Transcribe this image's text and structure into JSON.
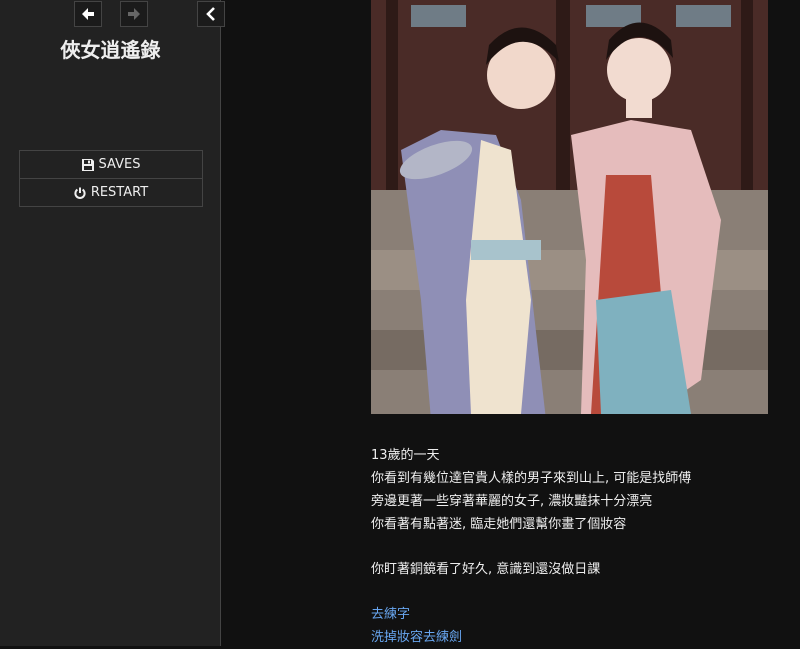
{
  "sidebar": {
    "title": "俠女逍遙錄",
    "nav": {
      "back_icon": "arrow-left-icon",
      "forward_icon": "arrow-right-icon",
      "toggle_icon": "chevron-left-icon"
    },
    "menu": [
      {
        "label": "SAVES",
        "icon": "floppy-disk-icon"
      },
      {
        "label": "RESTART",
        "icon": "power-icon"
      }
    ]
  },
  "passage": {
    "lines": [
      "13歲的一天",
      "你看到有幾位達官貴人樣的男子來到山上, 可能是找師傅",
      "旁邊更著一些穿著華麗的女子, 濃妝豔抹十分漂亮",
      "你看著有點著迷, 臨走她們還幫你畫了個妝容"
    ],
    "line2": "你盯著銅鏡看了好久, 意識到還沒做日課",
    "links": [
      "去練字",
      "洗掉妝容去練劍"
    ]
  },
  "colors": {
    "sidebar_bg": "#222222",
    "page_bg": "#111111",
    "link": "#68a6f0",
    "text": "#eeeeee"
  }
}
